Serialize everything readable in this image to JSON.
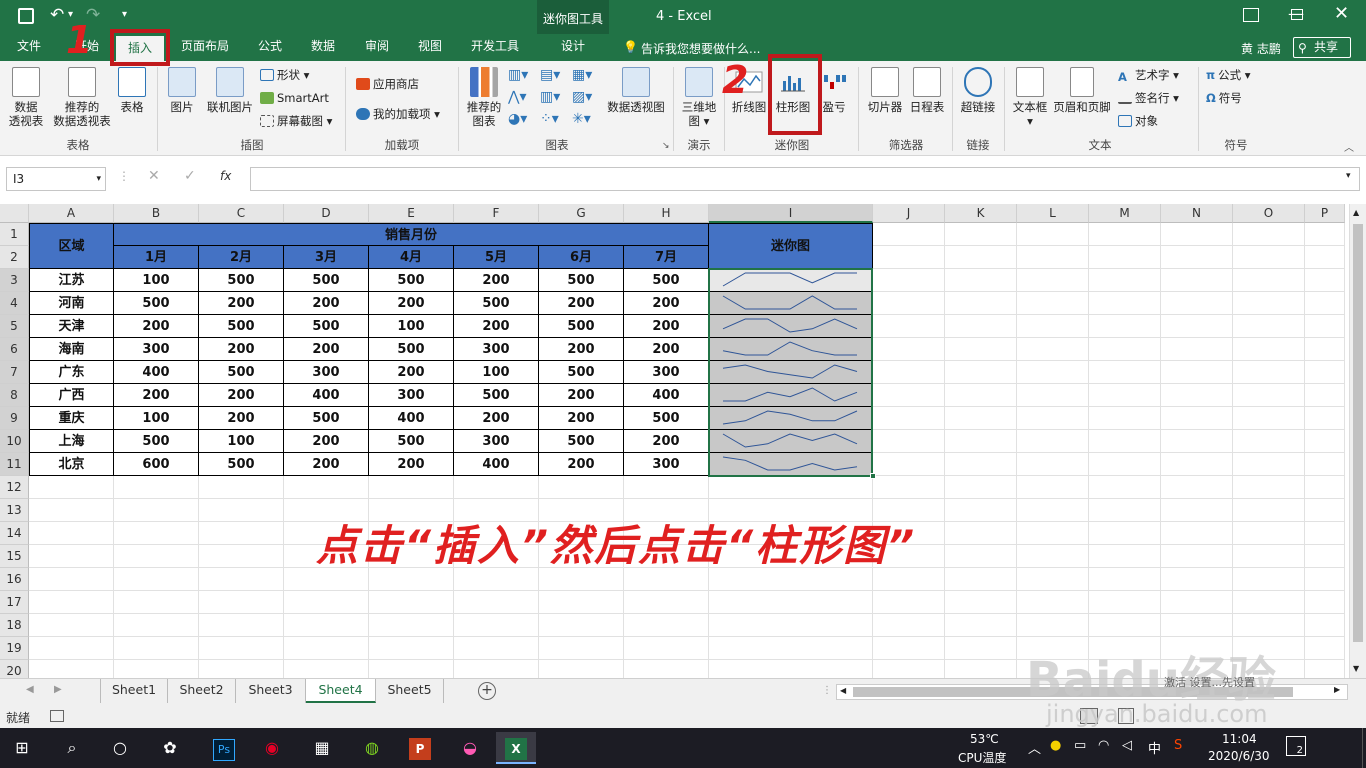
{
  "titlebar": {
    "title": "4  -  Excel",
    "context_tool": "迷你图工具",
    "colors": {
      "bar": "#217346",
      "context": "#1b5e3a"
    }
  },
  "tabs": [
    "文件",
    "开始",
    "插入",
    "页面布局",
    "公式",
    "数据",
    "审阅",
    "视图",
    "开发工具",
    "设计"
  ],
  "tell_me": "告诉我您想要做什么...",
  "user": "黄 志鹏",
  "share": "共享",
  "ribbon": {
    "groups": [
      "表格",
      "插图",
      "加载项",
      "图表",
      "演示",
      "迷你图",
      "筛选器",
      "链接",
      "文本",
      "符号"
    ],
    "table": {
      "pivot": [
        "数据",
        "透视表"
      ],
      "recommended_pivot": [
        "推荐的",
        "数据透视表"
      ],
      "table": "表格"
    },
    "illustrations": {
      "picture": "图片",
      "online_picture": "联机图片",
      "shapes": "形状",
      "smartart": "SmartArt",
      "screenshot": "屏幕截图"
    },
    "addins": {
      "store": "应用商店",
      "my_addins": "我的加载项"
    },
    "charts": {
      "recommended": [
        "推荐的",
        "图表"
      ],
      "pivot_chart": "数据透视图"
    },
    "tours": {
      "map3d": [
        "三维地",
        "图"
      ]
    },
    "sparklines": {
      "line": "折线图",
      "column": "柱形图",
      "winloss": "盈亏"
    },
    "filters": {
      "slicer": "切片器",
      "timeline": "日程表"
    },
    "links": {
      "hyperlink": "超链接"
    },
    "text": {
      "textbox": "文本框",
      "header_footer": "页眉和页脚",
      "wordart": "艺术字",
      "signature": "签名行",
      "object": "对象"
    },
    "symbols": {
      "equation": "公式",
      "symbol": "符号"
    }
  },
  "annotations": {
    "marker1": "1",
    "marker2": "2",
    "caption": "点击“插入”然后点击“柱形图”",
    "color": "#e02020"
  },
  "formula_bar": {
    "name_box": "I3",
    "fx": "fx",
    "formula": ""
  },
  "columns": [
    "A",
    "B",
    "C",
    "D",
    "E",
    "F",
    "G",
    "H",
    "I",
    "J",
    "K",
    "L",
    "M",
    "N",
    "O",
    "P"
  ],
  "rows": [
    "1",
    "2",
    "3",
    "4",
    "5",
    "6",
    "7",
    "8",
    "9",
    "10",
    "11",
    "12",
    "13",
    "14",
    "15",
    "16",
    "17",
    "18",
    "19",
    "20"
  ],
  "table": {
    "region_header": "区域",
    "sales_header": "销售月份",
    "sparkline_header": "迷你图",
    "months": [
      "1月",
      "2月",
      "3月",
      "4月",
      "5月",
      "6月",
      "7月"
    ],
    "data": [
      {
        "region": "江苏",
        "values": [
          100,
          500,
          500,
          500,
          200,
          500,
          500
        ]
      },
      {
        "region": "河南",
        "values": [
          500,
          200,
          200,
          200,
          500,
          200,
          200
        ]
      },
      {
        "region": "天津",
        "values": [
          200,
          500,
          500,
          100,
          200,
          500,
          200
        ]
      },
      {
        "region": "海南",
        "values": [
          300,
          200,
          200,
          500,
          300,
          200,
          200
        ]
      },
      {
        "region": "广东",
        "values": [
          400,
          500,
          300,
          200,
          100,
          500,
          300
        ]
      },
      {
        "region": "广西",
        "values": [
          200,
          200,
          400,
          300,
          500,
          200,
          400
        ]
      },
      {
        "region": "重庆",
        "values": [
          100,
          200,
          500,
          400,
          200,
          200,
          500
        ]
      },
      {
        "region": "上海",
        "values": [
          500,
          100,
          200,
          500,
          300,
          500,
          200
        ]
      },
      {
        "region": "北京",
        "values": [
          600,
          500,
          200,
          200,
          400,
          200,
          300
        ]
      }
    ],
    "header_color": "#4472c4",
    "sparkline_bg": "#c8c8c8",
    "sparkline_color": "#2f5597"
  },
  "sheets": [
    "Sheet1",
    "Sheet2",
    "Sheet3",
    "Sheet4",
    "Sheet5"
  ],
  "active_sheet": "Sheet4",
  "status": {
    "ready": "就绪"
  },
  "watermark": {
    "logo": "Baidu经验",
    "url": "jingyan.baidu.com",
    "notice": "激活 设置...先设置"
  },
  "taskbar": {
    "temp": "53℃",
    "cpu": "CPU温度",
    "ime": "中",
    "time": "11:04",
    "date": "2020/6/30",
    "notify_count": "2"
  }
}
